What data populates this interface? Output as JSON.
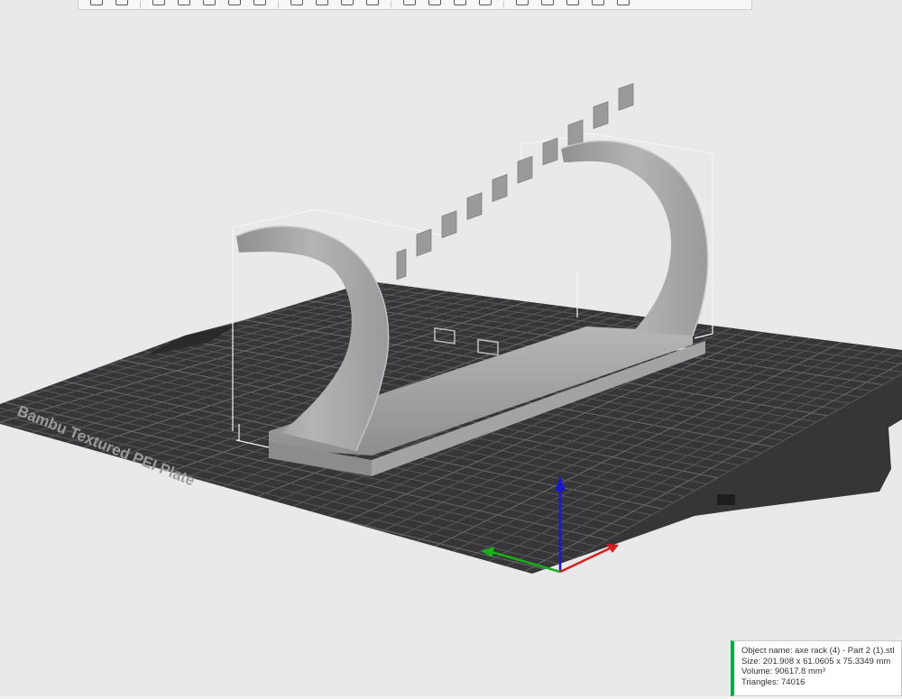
{
  "plate": {
    "label": "Bambu Textured PEI Plate",
    "plate_icons": [
      "close-icon",
      "arrange-icon",
      "layout-icon",
      "lock-icon",
      "settings-icon"
    ]
  },
  "toolbar": {
    "buttons": [
      "add-icon",
      "add-plate-icon",
      "orient-icon",
      "arrange-icon",
      "split-objects-icon",
      "split-parts-icon",
      "layers-icon",
      "move-icon",
      "rotate-icon",
      "scale-icon",
      "lay-on-face-icon",
      "cut-icon",
      "support-paint-icon",
      "seam-paint-icon",
      "color-paint-icon",
      "mesh-boolean-icon",
      "measure-icon",
      "text-icon",
      "svg-icon",
      "assembly-icon"
    ]
  },
  "object_info": {
    "name_label": "Object name:",
    "name_value": "axe rack (4) - Part 2 (1).stl",
    "size_label": "Size:",
    "size_value": "201.908 x 61.0605 x 75.3349 mm",
    "volume_label": "Volume:",
    "volume_value": "90617.8 mm³",
    "triangles_label": "Triangles:",
    "triangles_value": "74016"
  },
  "colors": {
    "background": "#e9e9ea",
    "plate": "#3a3a3c",
    "grid": "#5a5a5c",
    "model": "#a9a9aa",
    "accent": "#00ae42",
    "axis_x": "#e02020",
    "axis_y": "#18b018",
    "axis_z": "#1818d0"
  }
}
